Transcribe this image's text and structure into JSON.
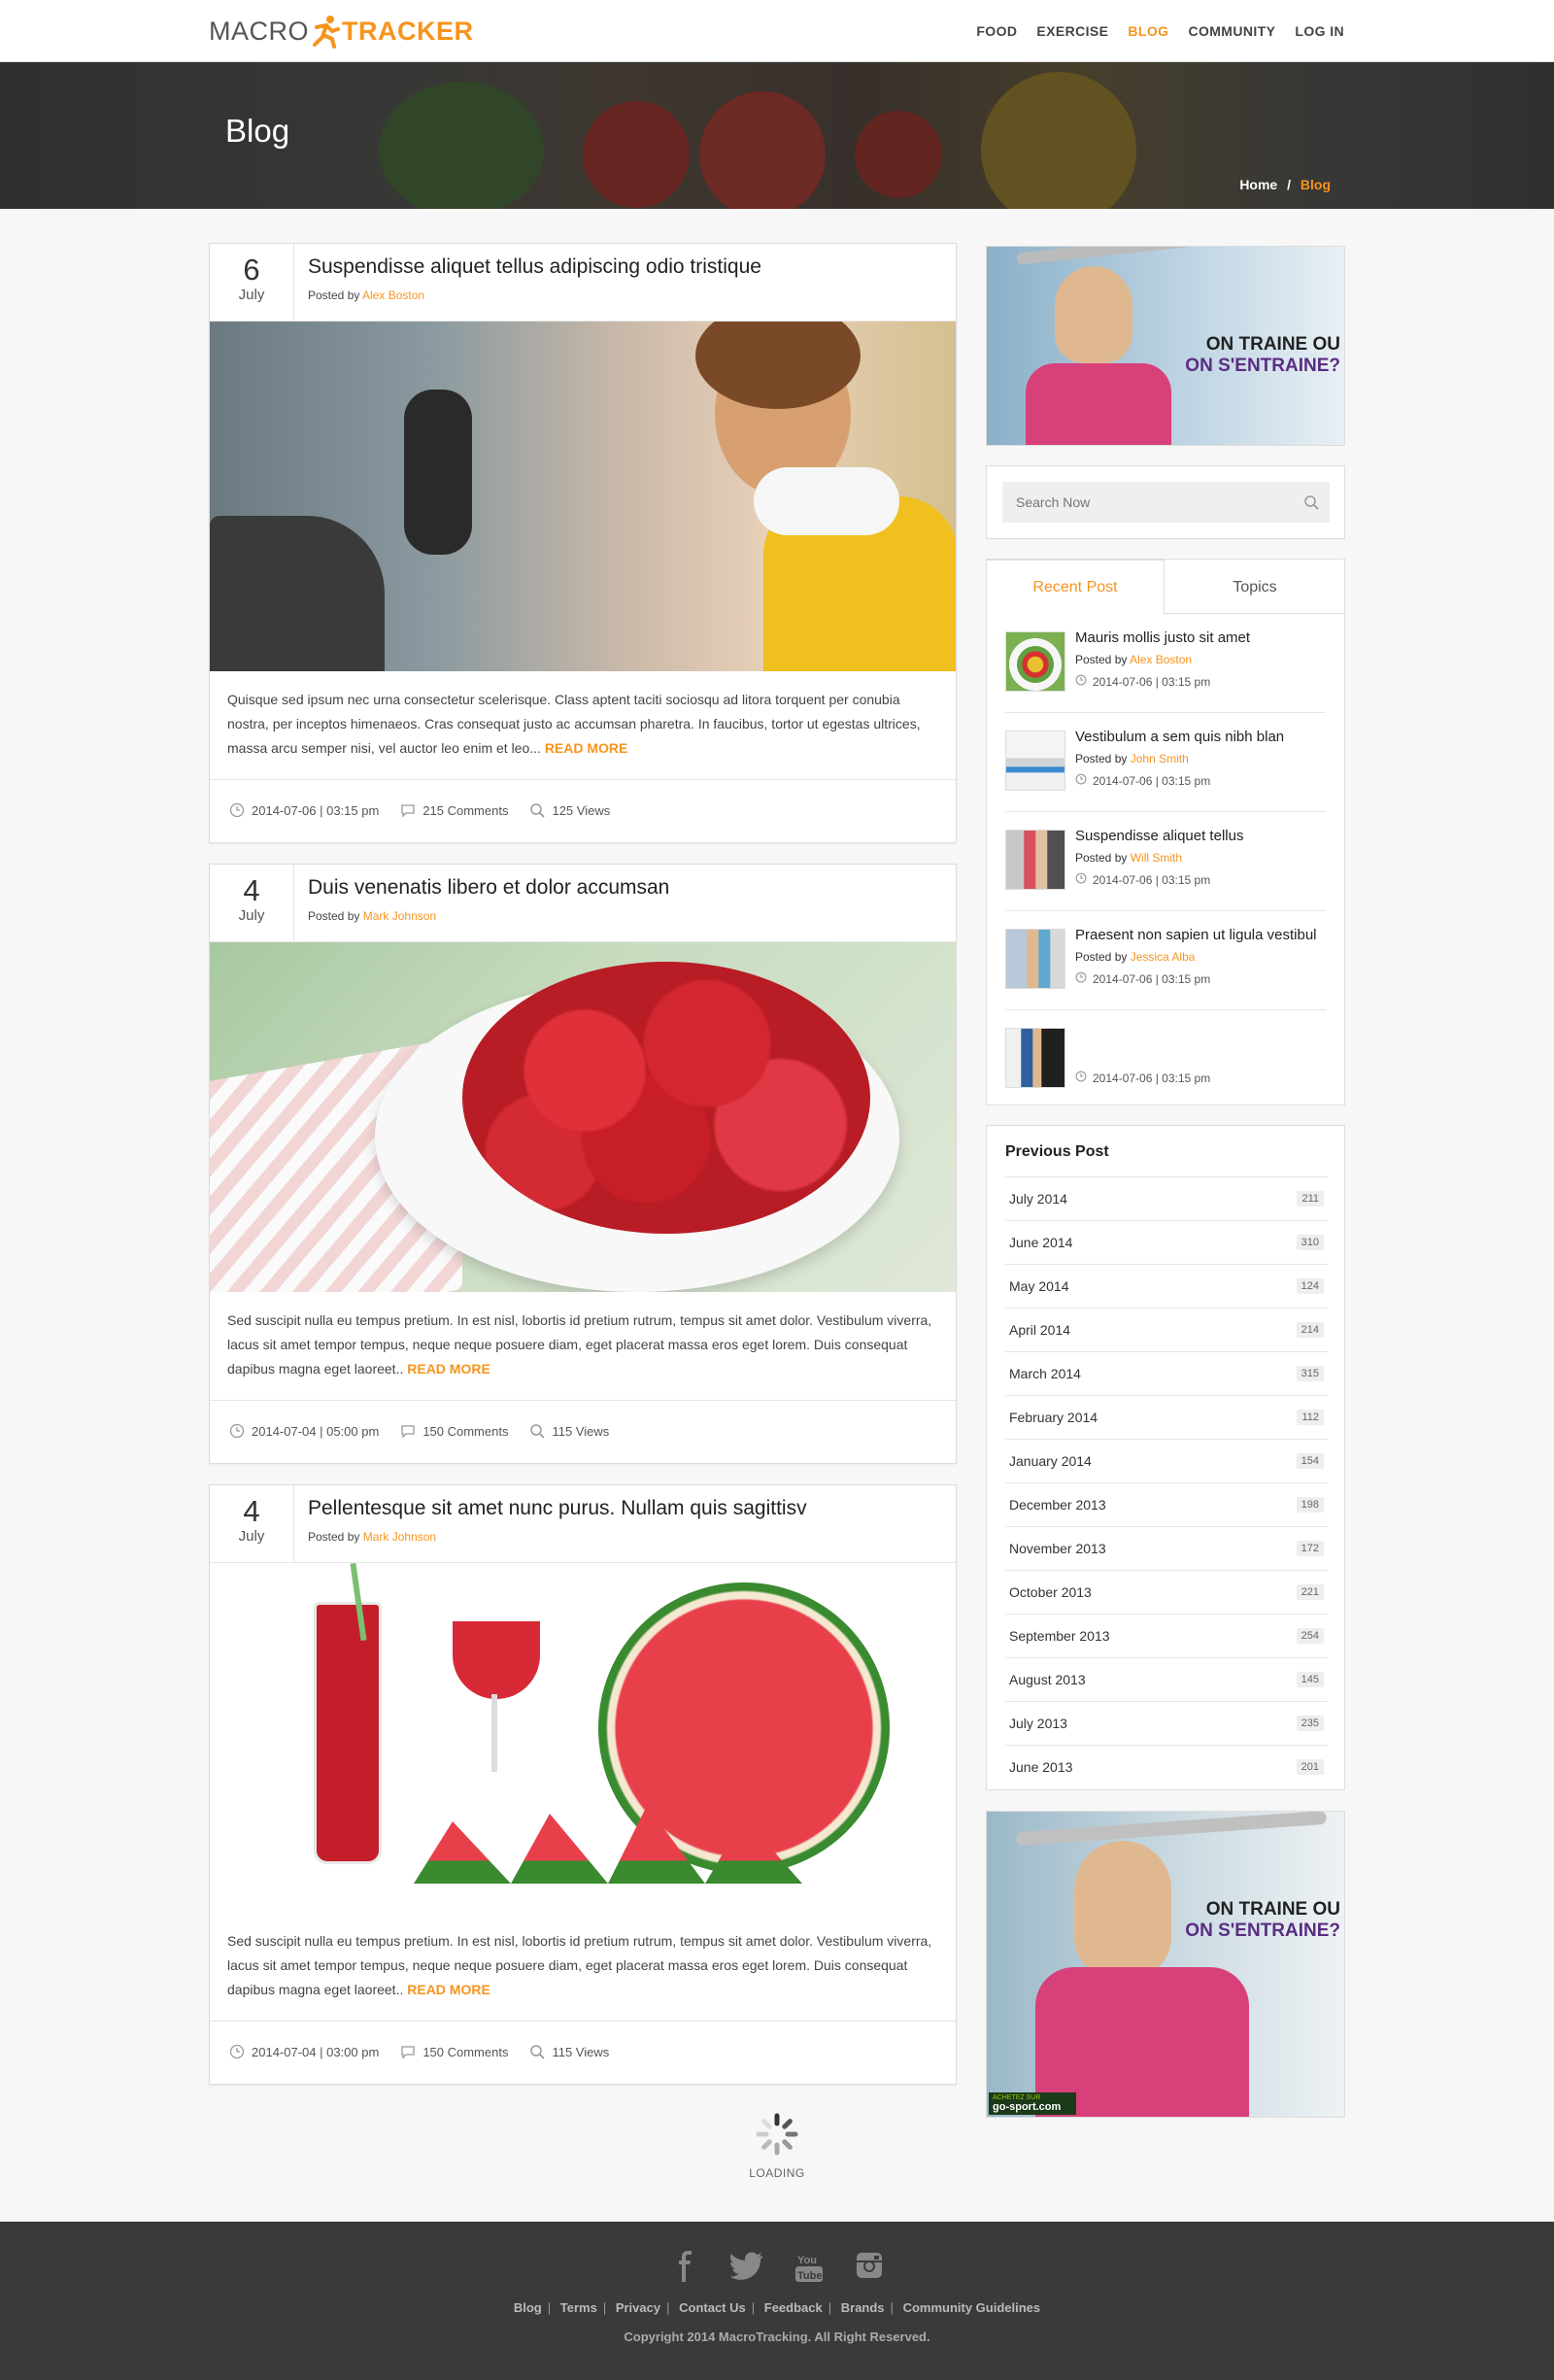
{
  "header": {
    "logo_macro": "MACRO",
    "logo_tracker": "TRACKER",
    "nav": [
      {
        "label": "FOOD"
      },
      {
        "label": "EXERCISE"
      },
      {
        "label": "BLOG"
      },
      {
        "label": "COMMUNITY"
      },
      {
        "label": "LOG IN"
      }
    ],
    "active_nav": "BLOG"
  },
  "hero": {
    "title": "Blog",
    "breadcrumb_home": "Home",
    "breadcrumb_sep": "/",
    "breadcrumb_current": "Blog"
  },
  "posts": [
    {
      "day": "6",
      "month": "July",
      "title": "Suspendisse aliquet tellus adipiscing odio tristique",
      "posted_by": "Posted by",
      "author": "Alex Boston",
      "excerpt": "Quisque sed ipsum nec urna consectetur scelerisque. Class aptent taciti sociosqu ad litora torquent per conubia nostra, per inceptos himenaeos. Cras consequat justo ac accumsan pharetra. In faucibus, tortor ut egestas ultrices, massa arcu semper nisi, vel auctor leo enim et leo...",
      "read_more": "READ MORE",
      "datetime": "2014-07-06 | 03:15 pm",
      "comments": "215 Comments",
      "views": "125 Views",
      "image": "woman-cycling-gym"
    },
    {
      "day": "4",
      "month": "July",
      "title": "Duis venenatis libero et dolor accumsan",
      "posted_by": "Posted by",
      "author": "Mark Johnson",
      "excerpt": "Sed suscipit nulla eu tempus pretium. In est nisl, lobortis id pretium rutrum, tempus sit amet dolor. Vestibulum viverra, lacus sit amet tempor tempus, neque neque posuere diam, eget placerat massa eros eget lorem. Duis consequat dapibus magna eget laoreet..",
      "read_more": "READ MORE",
      "datetime": "2014-07-04 | 05:00 pm",
      "comments": "150 Comments",
      "views": "115 Views",
      "image": "strawberries-bowl"
    },
    {
      "day": "4",
      "month": "July",
      "title": "Pellentesque sit amet nunc purus. Nullam quis sagittisv",
      "posted_by": "Posted by",
      "author": "Mark Johnson",
      "excerpt": "Sed suscipit nulla eu tempus pretium. In est nisl, lobortis id pretium rutrum, tempus sit amet dolor. Vestibulum viverra, lacus sit amet tempor tempus, neque neque posuere diam, eget placerat massa eros eget lorem. Duis consequat dapibus magna eget laoreet..",
      "read_more": "READ MORE",
      "datetime": "2014-07-04 | 03:00 pm",
      "comments": "150 Comments",
      "views": "115 Views",
      "image": "watermelon-juice"
    }
  ],
  "ad": {
    "line1": "ON TRAINE OU",
    "line2": "ON S'ENTRAINE?",
    "badge_small": "ACHETEZ SUR",
    "badge_site": "go-sport.com"
  },
  "search": {
    "placeholder": "Search Now"
  },
  "sidebar_tabs": {
    "recent": "Recent Post",
    "topics": "Topics"
  },
  "recent_posts": [
    {
      "title": "Mauris mollis justo sit amet",
      "posted_by": "Posted by",
      "author": "Alex Boston",
      "datetime": "2014-07-06 | 03:15 pm",
      "thumb": "fruit-plate"
    },
    {
      "title": "Vestibulum a sem quis nibh blan",
      "posted_by": "Posted by",
      "author": "John Smith",
      "datetime": "2014-07-06 | 03:15 pm",
      "thumb": "floor-exercise"
    },
    {
      "title": "Suspendisse aliquet tellus",
      "posted_by": "Posted by",
      "author": "Will Smith",
      "datetime": "2014-07-06 | 03:15 pm",
      "thumb": "gym-group"
    },
    {
      "title": "Praesent non sapien ut ligula vestibul",
      "posted_by": "Posted by",
      "author": "Jessica Alba",
      "datetime": "2014-07-06 | 03:15 pm",
      "thumb": "woman-gym"
    },
    {
      "title": "",
      "posted_by": "",
      "author": "",
      "datetime": "2014-07-06 | 03:15 pm",
      "thumb": "cycling-class"
    }
  ],
  "archive": {
    "title": "Previous Post",
    "items": [
      {
        "month": "July 2014",
        "count": "211"
      },
      {
        "month": "June 2014",
        "count": "310"
      },
      {
        "month": "May 2014",
        "count": "124"
      },
      {
        "month": "April 2014",
        "count": "214"
      },
      {
        "month": "March 2014",
        "count": "315"
      },
      {
        "month": "February 2014",
        "count": "112"
      },
      {
        "month": "January 2014",
        "count": "154"
      },
      {
        "month": "December 2013",
        "count": "198"
      },
      {
        "month": "November 2013",
        "count": "172"
      },
      {
        "month": "October 2013",
        "count": "221"
      },
      {
        "month": "September 2013",
        "count": "254"
      },
      {
        "month": "August 2013",
        "count": "145"
      },
      {
        "month": "July 2013",
        "count": "235"
      },
      {
        "month": "June 2013",
        "count": "201"
      }
    ]
  },
  "loading": "LOADING",
  "footer": {
    "social": [
      "facebook-icon",
      "twitter-icon",
      "youtube-icon",
      "instagram-icon"
    ],
    "links": [
      {
        "label": "Blog"
      },
      {
        "label": "Terms"
      },
      {
        "label": "Privacy"
      },
      {
        "label": "Contact Us"
      },
      {
        "label": "Feedback"
      },
      {
        "label": "Brands"
      },
      {
        "label": "Community Guidelines"
      }
    ],
    "copyright": "Copyright 2014 MacroTracking. All Right Reserved."
  },
  "colors": {
    "accent": "#f7941d",
    "footer": "#3a3a3a",
    "purple": "#5a2d82"
  }
}
